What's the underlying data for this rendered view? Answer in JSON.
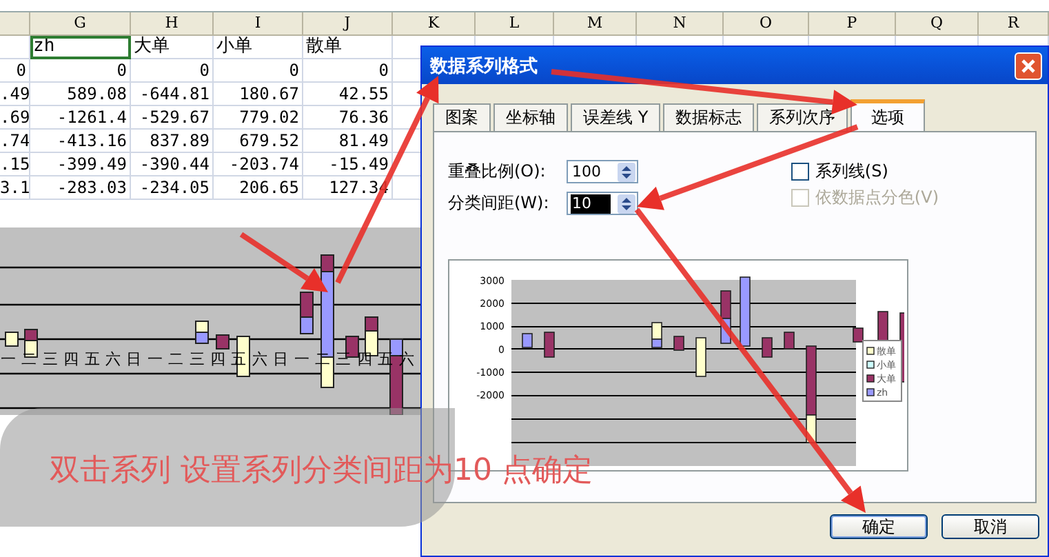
{
  "sheet": {
    "columns": [
      "",
      "G",
      "H",
      "I",
      "J",
      "K",
      "L",
      "M",
      "N",
      "O",
      "P",
      "Q",
      "R"
    ],
    "header": [
      {
        "text": "zh",
        "selected": true
      },
      {
        "text": "大单",
        "selected": false
      },
      {
        "text": "小单",
        "selected": false
      },
      {
        "text": "散单",
        "selected": false
      }
    ],
    "rows": [
      [
        "0",
        "0",
        "0",
        "0",
        "0"
      ],
      [
        ".49",
        "589.08",
        "-644.81",
        "180.67",
        "42.55"
      ],
      [
        ".69",
        "-1261.4",
        "-529.67",
        "779.02",
        "76.36"
      ],
      [
        ".74",
        "-413.16",
        "837.89",
        "679.52",
        "81.49"
      ],
      [
        ".15",
        "-399.49",
        "-390.44",
        "-203.74",
        "-15.49"
      ],
      [
        "3.1",
        "-283.03",
        "-234.05",
        "206.65",
        "127.34"
      ]
    ]
  },
  "chart": {
    "axis_labels": [
      "一",
      "二",
      "三",
      "四",
      "五",
      "六",
      "日",
      "一",
      "二",
      "三",
      "四",
      "五",
      "六",
      "日",
      "一",
      "二",
      "三",
      "四",
      "五",
      "六"
    ]
  },
  "dialog": {
    "title": "数据系列格式",
    "tabs": [
      {
        "label": "图案",
        "selected": false
      },
      {
        "label": "坐标轴",
        "selected": false
      },
      {
        "label": "误差线 Y",
        "selected": false
      },
      {
        "label": "数据标志",
        "selected": false
      },
      {
        "label": "系列次序",
        "selected": false
      },
      {
        "label": "选项",
        "selected": true
      }
    ],
    "fields": [
      {
        "label": "重叠比例(O):",
        "value": "100",
        "highlighted": false
      },
      {
        "label": "分类间距(W):",
        "value": "10",
        "highlighted": true
      }
    ],
    "checkboxes": [
      {
        "label": "系列线(S)",
        "checked": false,
        "disabled": false
      },
      {
        "label": "依数据点分色(V)",
        "checked": false,
        "disabled": true
      }
    ],
    "preview": {
      "y_ticks": [
        "3000",
        "2000",
        "1000",
        "0",
        "-1000",
        "-2000"
      ],
      "legend": [
        {
          "label": "散单",
          "color": "#ffffcc"
        },
        {
          "label": "小单",
          "color": "#ccffff"
        },
        {
          "label": "大单",
          "color": "#993366"
        },
        {
          "label": "zh",
          "color": "#9999ff"
        }
      ]
    },
    "buttons": [
      "确定",
      "取消"
    ]
  },
  "caption": "双击系列 设置系列分类间距为10 点确定"
}
